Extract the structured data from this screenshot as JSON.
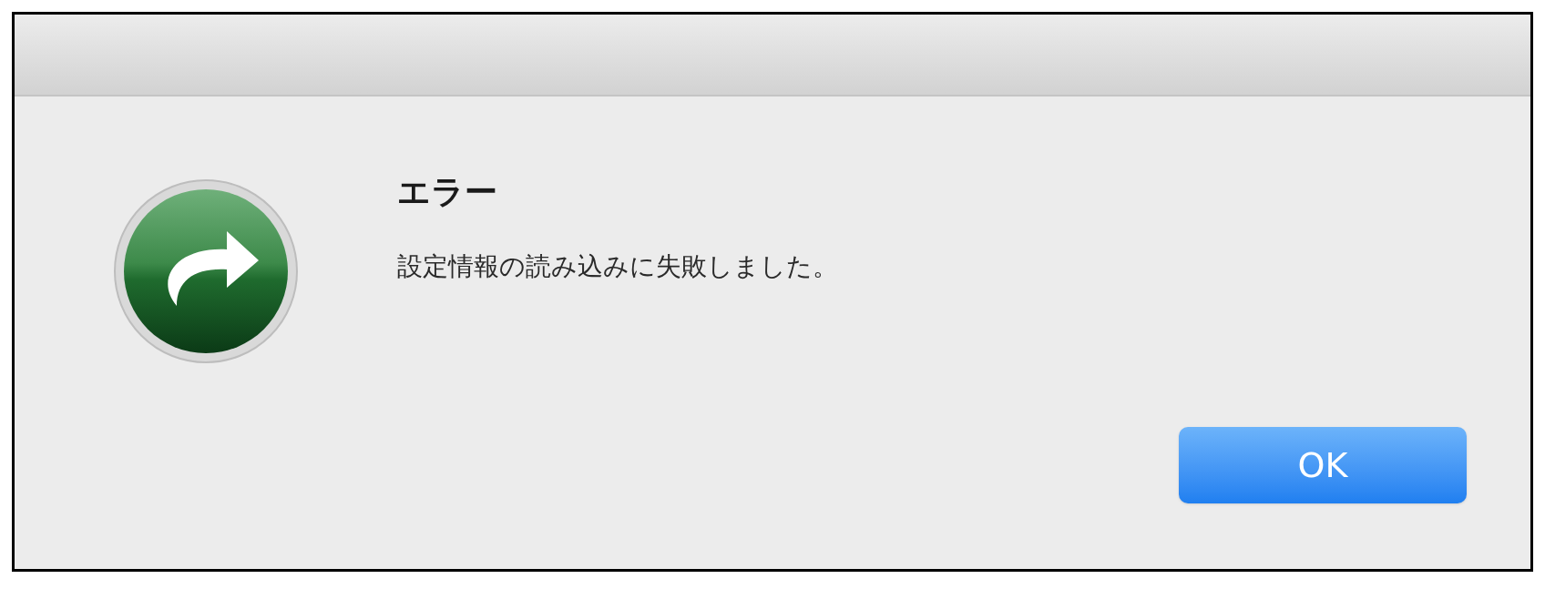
{
  "dialog": {
    "title": "エラー",
    "message": "設定情報の読み込みに失敗しました。",
    "buttons": [
      {
        "label": "OK",
        "kind": "default"
      }
    ]
  }
}
